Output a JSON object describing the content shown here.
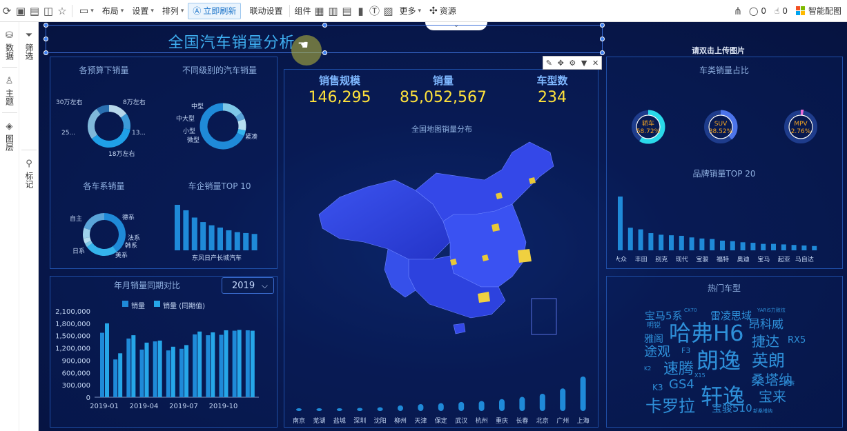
{
  "toolbar": {
    "layout": "布局",
    "settings": "设置",
    "arrange": "排列",
    "refresh": "立即刷新",
    "linkage": "联动设置",
    "component": "组件",
    "more": "更多",
    "resources": "资源",
    "comments": "0",
    "likes": "0",
    "smart": "智能配图"
  },
  "sidebar": {
    "data": "数据",
    "filter": "筛选",
    "theme": "主题",
    "layers": "图层",
    "annotate": "标记"
  },
  "dashboard": {
    "title": "全国汽车销量分析",
    "upload_hint": "请双击上传图片",
    "kpis": [
      {
        "label": "销售规模",
        "value": "146,295"
      },
      {
        "label": "销量",
        "value": "85,052,567"
      },
      {
        "label": "车型数",
        "value": "234"
      }
    ],
    "panels": {
      "budget": "各预算下销量",
      "level": "不同级别的汽车销量",
      "series": "各车系销量",
      "top10": "车企销量TOP 10",
      "map": "全国地图销量分布",
      "share": "车类销量占比",
      "brand20": "品牌销量TOP 20",
      "hot": "热门车型",
      "yoy": "年月销量同期对比"
    },
    "year_select": "2019",
    "legend": [
      "销量",
      "销量 (同期值)"
    ]
  },
  "chart_data": [
    {
      "type": "pie",
      "title": "各预算下销量",
      "labels": [
        "30万左右",
        "8万左右",
        "13...",
        "18万左右",
        "25..."
      ],
      "values": [
        12,
        10,
        30,
        20,
        8
      ]
    },
    {
      "type": "pie",
      "title": "不同级别的汽车销量",
      "labels": [
        "中型",
        "中大型",
        "小型",
        "微型",
        "紧凑"
      ],
      "values": [
        15,
        5,
        8,
        4,
        68
      ]
    },
    {
      "type": "pie",
      "title": "各车系销量",
      "labels": [
        "自主",
        "德系",
        "法系",
        "韩系",
        "美系",
        "日系"
      ],
      "values": [
        40,
        25,
        3,
        4,
        8,
        20
      ]
    },
    {
      "type": "bar",
      "title": "车企销量TOP 10",
      "categories": [
        "",
        "",
        "",
        "",
        "",
        "",
        "",
        "",
        "",
        ""
      ],
      "values": [
        100,
        88,
        72,
        62,
        55,
        50,
        44,
        40,
        38,
        36
      ],
      "xlabel_text": "东风日产长城汽车"
    },
    {
      "type": "pie",
      "title": "车类销量占比",
      "labels": [
        "轿车",
        "SUV",
        "MPV"
      ],
      "values": [
        58.72,
        38.52,
        2.76
      ],
      "value_labels": [
        "58.72%",
        "38.52%",
        "2.76%"
      ]
    },
    {
      "type": "bar",
      "title": "品牌销量TOP 20",
      "categories": [
        "大众",
        "丰田",
        "别克",
        "现代",
        "宝骏",
        "福特",
        "奥迪",
        "宝马",
        "起亚",
        "马自达"
      ],
      "values": [
        100,
        42,
        39,
        32,
        29,
        28,
        27,
        24,
        22,
        21,
        18,
        17,
        15,
        14,
        12,
        12,
        11,
        10,
        9,
        8
      ]
    },
    {
      "type": "bar",
      "title": "",
      "categories": [
        "南京",
        "芜湖",
        "盐城",
        "深圳",
        "沈阳",
        "柳州",
        "天津",
        "保定",
        "武汉",
        "杭州",
        "重庆",
        "长春",
        "北京",
        "广州",
        "上海"
      ],
      "values": [
        40,
        60,
        80,
        100,
        120,
        180,
        220,
        250,
        290,
        320,
        380,
        450,
        550,
        720,
        1100
      ]
    },
    {
      "type": "bar",
      "title": "年月销量同期对比",
      "x": [
        "2019-01",
        "2019-02",
        "2019-03",
        "2019-04",
        "2019-05",
        "2019-06",
        "2019-07",
        "2019-08",
        "2019-09",
        "2019-10",
        "2019-11",
        "2019-12"
      ],
      "xticks": [
        "2019-01",
        "2019-04",
        "2019-07",
        "2019-10"
      ],
      "yticks": [
        "0",
        "300,000",
        "600,000",
        "900,000",
        "1,200,000",
        "1,500,000",
        "1,800,000",
        "2,100,000"
      ],
      "ylim": [
        0,
        2100000
      ],
      "series": [
        {
          "name": "销量",
          "values": [
            1570000,
            920000,
            1430000,
            1160000,
            1360000,
            1140000,
            1180000,
            1530000,
            1510000,
            1520000,
            1620000,
            1630000
          ]
        },
        {
          "name": "销量 (同期值)",
          "values": [
            1800000,
            1070000,
            1510000,
            1330000,
            1380000,
            1230000,
            1270000,
            1600000,
            1580000,
            1630000,
            1640000,
            1620000
          ]
        }
      ]
    }
  ],
  "word_cloud": [
    {
      "text": "宝马5系",
      "size": 15
    },
    {
      "text": "CX70",
      "size": 7
    },
    {
      "text": "雷凌思域",
      "size": 15
    },
    {
      "text": "YARiS力致炫",
      "size": 7
    },
    {
      "text": "明锐",
      "size": 10
    },
    {
      "text": "哈弗H6",
      "size": 32
    },
    {
      "text": "昂科威",
      "size": 17
    },
    {
      "text": "雅阁",
      "size": 14
    },
    {
      "text": "捷达",
      "size": 20
    },
    {
      "text": "RX5",
      "size": 13
    },
    {
      "text": "途观",
      "size": 19
    },
    {
      "text": "F3",
      "size": 11
    },
    {
      "text": "朗逸",
      "size": 32
    },
    {
      "text": "英朗",
      "size": 24
    },
    {
      "text": "K2",
      "size": 8
    },
    {
      "text": "速腾",
      "size": 22
    },
    {
      "text": "X15",
      "size": 8
    },
    {
      "text": "桑塔纳",
      "size": 20
    },
    {
      "text": "K3",
      "size": 12
    },
    {
      "text": "GS4",
      "size": 18
    },
    {
      "text": "轩逸",
      "size": 32
    },
    {
      "text": "宝来",
      "size": 20
    },
    {
      "text": "卡罗拉",
      "size": 24
    },
    {
      "text": "宝骏510",
      "size": 15
    },
    {
      "text": "新桑塔纳",
      "size": 7
    },
    {
      "text": "奥赛",
      "size": 7
    }
  ],
  "colors": {
    "accent": "#1f8ad8",
    "kpi": "#ffe23b",
    "title": "#3fb0f2",
    "map_base": "#2f47e6",
    "map_hot": "#f0d040"
  }
}
